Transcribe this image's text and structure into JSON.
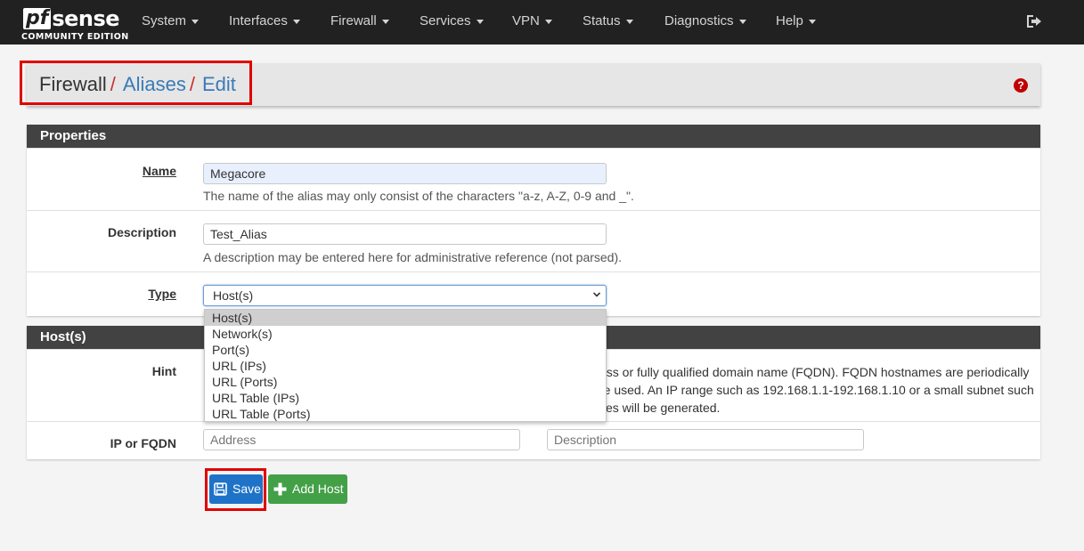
{
  "nav": {
    "logo_main_a": "pf",
    "logo_main_b": "sense",
    "logo_sub": "COMMUNITY EDITION",
    "items": [
      "System",
      "Interfaces",
      "Firewall",
      "Services",
      "VPN",
      "Status",
      "Diagnostics",
      "Help"
    ]
  },
  "breadcrumb": {
    "root": "Firewall",
    "level1": "Aliases",
    "level2": "Edit",
    "separator": "/"
  },
  "help_icon": "question-circle-icon",
  "properties": {
    "title": "Properties",
    "name_label": "Name",
    "name_value": "Megacore",
    "name_help": "The name of the alias may only consist of the characters \"a-z, A-Z, 0-9 and _\".",
    "description_label": "Description",
    "description_value": "Test_Alias",
    "description_help": "A description may be entered here for administrative reference (not parsed).",
    "type_label": "Type",
    "type_value": "Host(s)",
    "type_options": [
      "Host(s)",
      "Network(s)",
      "Port(s)",
      "URL (IPs)",
      "URL (Ports)",
      "URL Table (IPs)",
      "URL Table (Ports)"
    ]
  },
  "hosts": {
    "title": "Host(s)",
    "hint_label": "Hint",
    "hint_line1": "ess or fully qualified domain name (FQDN). FQDN hostnames are periodically",
    "hint_line2": "re used. An IP range such as 192.168.1.1-192.168.1.10 or a small subnet such",
    "hint_line3": "ses will be generated.",
    "ip_label": "IP or FQDN",
    "address_placeholder": "Address",
    "description_placeholder": "Description"
  },
  "buttons": {
    "save": "Save",
    "add_host": "Add Host"
  },
  "colors": {
    "navbar": "#212121",
    "panel_header": "#424242",
    "link": "#3a7ab8",
    "save_button": "#1e73c9",
    "add_button": "#43a047",
    "highlight": "#e00000"
  }
}
